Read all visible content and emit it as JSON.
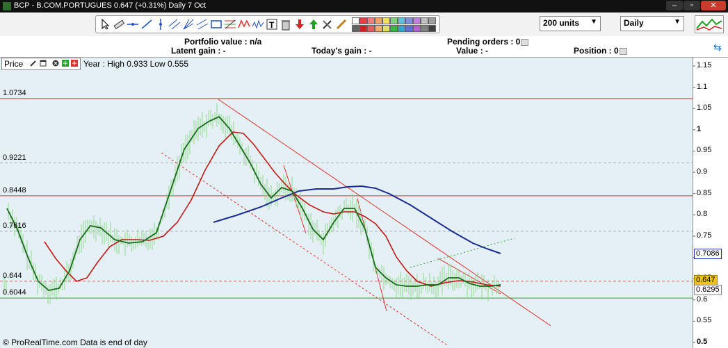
{
  "window": {
    "title": "BCP - B.COM.PORTUGUES   0.647 (+0.31%)   Daily  7 Oct",
    "minimize": "–",
    "maximize": "▫",
    "close": "✕"
  },
  "toolbar": {
    "units_select": "200 units",
    "period_select": "Daily",
    "swatch_colors": [
      "#ffffff",
      "#e84040",
      "#f08080",
      "#f4a460",
      "#f0e060",
      "#80d080",
      "#60c0e0",
      "#8090e0",
      "#c080e0",
      "#c0c0c0",
      "#a0a0a0",
      "#606060",
      "#d02020",
      "#e06060",
      "#f0b070",
      "#e0e060",
      "#40b040",
      "#40a0d0",
      "#6070d0",
      "#b060d0",
      "#808080",
      "#404040"
    ]
  },
  "portfolio": {
    "portfolio_value": "Portfolio value : n/a",
    "pending_orders": "Pending orders : 0",
    "latent_gain": "Latent gain : -",
    "todays_gain": "Today's gain : -",
    "value": "Value : -",
    "position": "Position : 0"
  },
  "chart": {
    "panel_label": "Price",
    "year_info": "Year : High 0.933 Low 0.555",
    "horizontal_lines": [
      {
        "label": "1.0734",
        "value": 1.0734,
        "color": "#e03030"
      },
      {
        "label": "0.9221",
        "value": 0.9221,
        "color": "#b0b0b0"
      },
      {
        "label": "0.8448",
        "value": 0.8448,
        "color": "#e03030"
      },
      {
        "label": "0.7616",
        "value": 0.7616,
        "color": "#b0b0b0"
      },
      {
        "label": "0.644",
        "value": 0.644,
        "color": "#e06060"
      },
      {
        "label": "0.6044",
        "value": 0.6044,
        "color": "#30a030"
      }
    ],
    "y_ticks": [
      "1.15",
      "1.1",
      "1.05",
      "1",
      "0.95",
      "0.9",
      "0.85",
      "0.8",
      "0.75",
      "0.7",
      "0.65",
      "0.6",
      "0.55",
      "0.5"
    ],
    "y_tick_values": [
      1.15,
      1.1,
      1.05,
      1,
      0.95,
      0.9,
      0.85,
      0.8,
      0.75,
      0.7,
      0.65,
      0.6,
      0.55,
      0.5
    ],
    "price_tags": [
      {
        "label": "0.7086",
        "value": 0.7086,
        "bg": "#ffffff",
        "border": "#2030a0"
      },
      {
        "label": "0.647",
        "value": 0.647,
        "bg": "#f0c020",
        "border": "#a08000"
      },
      {
        "label": "0.6295",
        "value": 0.6295,
        "bg": "#ffffff",
        "border": "#888888"
      }
    ],
    "colors": {
      "background": "#e5f0f5",
      "price_wicks": "#8fd88f",
      "ma_fast": "#1a6a1a",
      "ma_medium": "#c01818",
      "ma_long": "#1a2a90",
      "trendline": "#e03030"
    },
    "footer": "© ProRealTime.com Data is end of day"
  }
}
